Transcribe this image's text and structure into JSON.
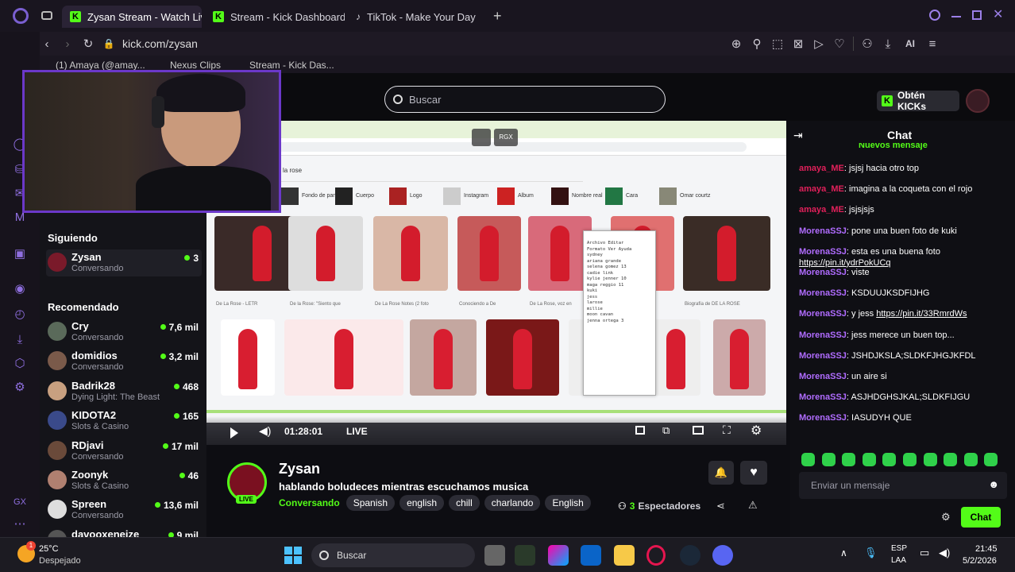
{
  "browser": {
    "tabs": [
      {
        "label": "Zysan Stream - Watch Live",
        "active": true
      },
      {
        "label": "Stream - Kick Dashboard"
      },
      {
        "label": "TikTok - Make Your Day"
      }
    ],
    "new_tab": "+",
    "url": "kick.com/zysan",
    "ai_label": "AI",
    "bookmarks": [
      "(1) Amaya (@amay...",
      "Nexus Clips",
      "Stream - Kick Das..."
    ]
  },
  "header": {
    "search_placeholder": "Buscar",
    "get_kicks": "Obtén KICKs"
  },
  "nav": {
    "following_title": "Siguiendo",
    "following": [
      {
        "name": "Zysan",
        "category": "Conversando",
        "viewers": "3"
      }
    ],
    "recommended_title": "Recomendado",
    "recommended": [
      {
        "name": "Cry",
        "category": "Conversando",
        "viewers": "7,6 mil"
      },
      {
        "name": "domidios",
        "category": "Conversando",
        "viewers": "3,2 mil"
      },
      {
        "name": "Badrik28",
        "category": "Dying Light: The Beast",
        "viewers": "468"
      },
      {
        "name": "KIDOTA2",
        "category": "Slots & Casino",
        "viewers": "165"
      },
      {
        "name": "RDjavi",
        "category": "Conversando",
        "viewers": "17 mil"
      },
      {
        "name": "Zoonyk",
        "category": "Slots & Casino",
        "viewers": "46"
      },
      {
        "name": "Spreen",
        "category": "Conversando",
        "viewers": "13,6 mil"
      },
      {
        "name": "davooxeneize",
        "category": "",
        "viewers": "9 mil"
      }
    ]
  },
  "player": {
    "time": "01:28:01",
    "live": "LIVE",
    "overlay_label": "RGX",
    "screen": {
      "search_query": "la rose",
      "filters": [
        "Fondo de pantalla",
        "Cuerpo",
        "Logo",
        "Instagram",
        "Album",
        "Nombre real",
        "Cara",
        "Omar courtz"
      ],
      "captions_row1": [
        "De La Rose - LETR",
        "De la Rose: \"Siento que",
        "De La Rose Notes (2 foto",
        "Conociendo a De",
        "De La Rose, voz en",
        "",
        "Biografía de DE LA ROSE"
      ],
      "notepad_lines": [
        "Archivo  Editar",
        "Formato  Ver  Ayuda",
        "sydney",
        "ariana grande",
        "selena gomez 13",
        "cadie link",
        "kylie jenner 10",
        "maga reggio 11",
        "kuki",
        "jess",
        "larose",
        "millie",
        "moon cavan",
        "jenna ortega 3"
      ]
    }
  },
  "stream": {
    "streamer": "Zysan",
    "title": "hablando boludeces mientras escuchamos musica",
    "category": "Conversando",
    "tags": [
      "Spanish",
      "english",
      "chill",
      "charlando",
      "English"
    ],
    "live_badge": "LIVE",
    "viewers_count": "3",
    "viewers_label": "Espectadores"
  },
  "chat": {
    "title": "Chat",
    "new_messages": "Nuevos mensaje",
    "messages": [
      {
        "user": "amaya_ME",
        "text": "jsjsj hacia otro top",
        "color": "#e0205a"
      },
      {
        "user": "amaya_ME",
        "text": "imagina a la coqueta con el rojo",
        "color": "#e0205a"
      },
      {
        "user": "amaya_ME",
        "text": "jsjsjsjs",
        "color": "#e0205a"
      },
      {
        "user": "MorenaSSJ",
        "text": "pone una buen foto de kuki",
        "color": "#b06cff"
      },
      {
        "user": "MorenaSSJ",
        "text": "esta es una buena foto",
        "link": "https://pin.it/ydrPokUCq",
        "color": "#b06cff"
      },
      {
        "user": "MorenaSSJ",
        "text": "viste",
        "color": "#b06cff"
      },
      {
        "user": "MorenaSSJ",
        "text": "KSDUUJKSDFIJHG",
        "color": "#b06cff"
      },
      {
        "user": "MorenaSSJ",
        "text": "y jess",
        "link": "https://pin.it/33RmrdWs",
        "color": "#b06cff"
      },
      {
        "user": "MorenaSSJ",
        "text": "jess merece un buen top...",
        "color": "#b06cff"
      },
      {
        "user": "MorenaSSJ",
        "text": "JSHDJKSLA;SLDKFJHGJKFDL",
        "color": "#b06cff"
      },
      {
        "user": "MorenaSSJ",
        "text": "un aire si",
        "color": "#b06cff"
      },
      {
        "user": "MorenaSSJ",
        "text": "ASJHDGHSJKAL;SLDKFIJGU",
        "color": "#b06cff"
      },
      {
        "user": "MorenaSSJ",
        "text": "IASUDYH QUE",
        "color": "#b06cff"
      }
    ],
    "input_placeholder": "Enviar un mensaje",
    "send_label": "Chat"
  },
  "taskbar": {
    "weather_temp": "25°C",
    "weather_desc": "Despejado",
    "search_label": "Buscar",
    "lang": "ESP",
    "layout": "LAA",
    "time": "21:45",
    "date": "5/2/2026",
    "notif_count": "1"
  },
  "colors": {
    "kick_green": "#53fc18",
    "purple": "#6b38c9"
  }
}
